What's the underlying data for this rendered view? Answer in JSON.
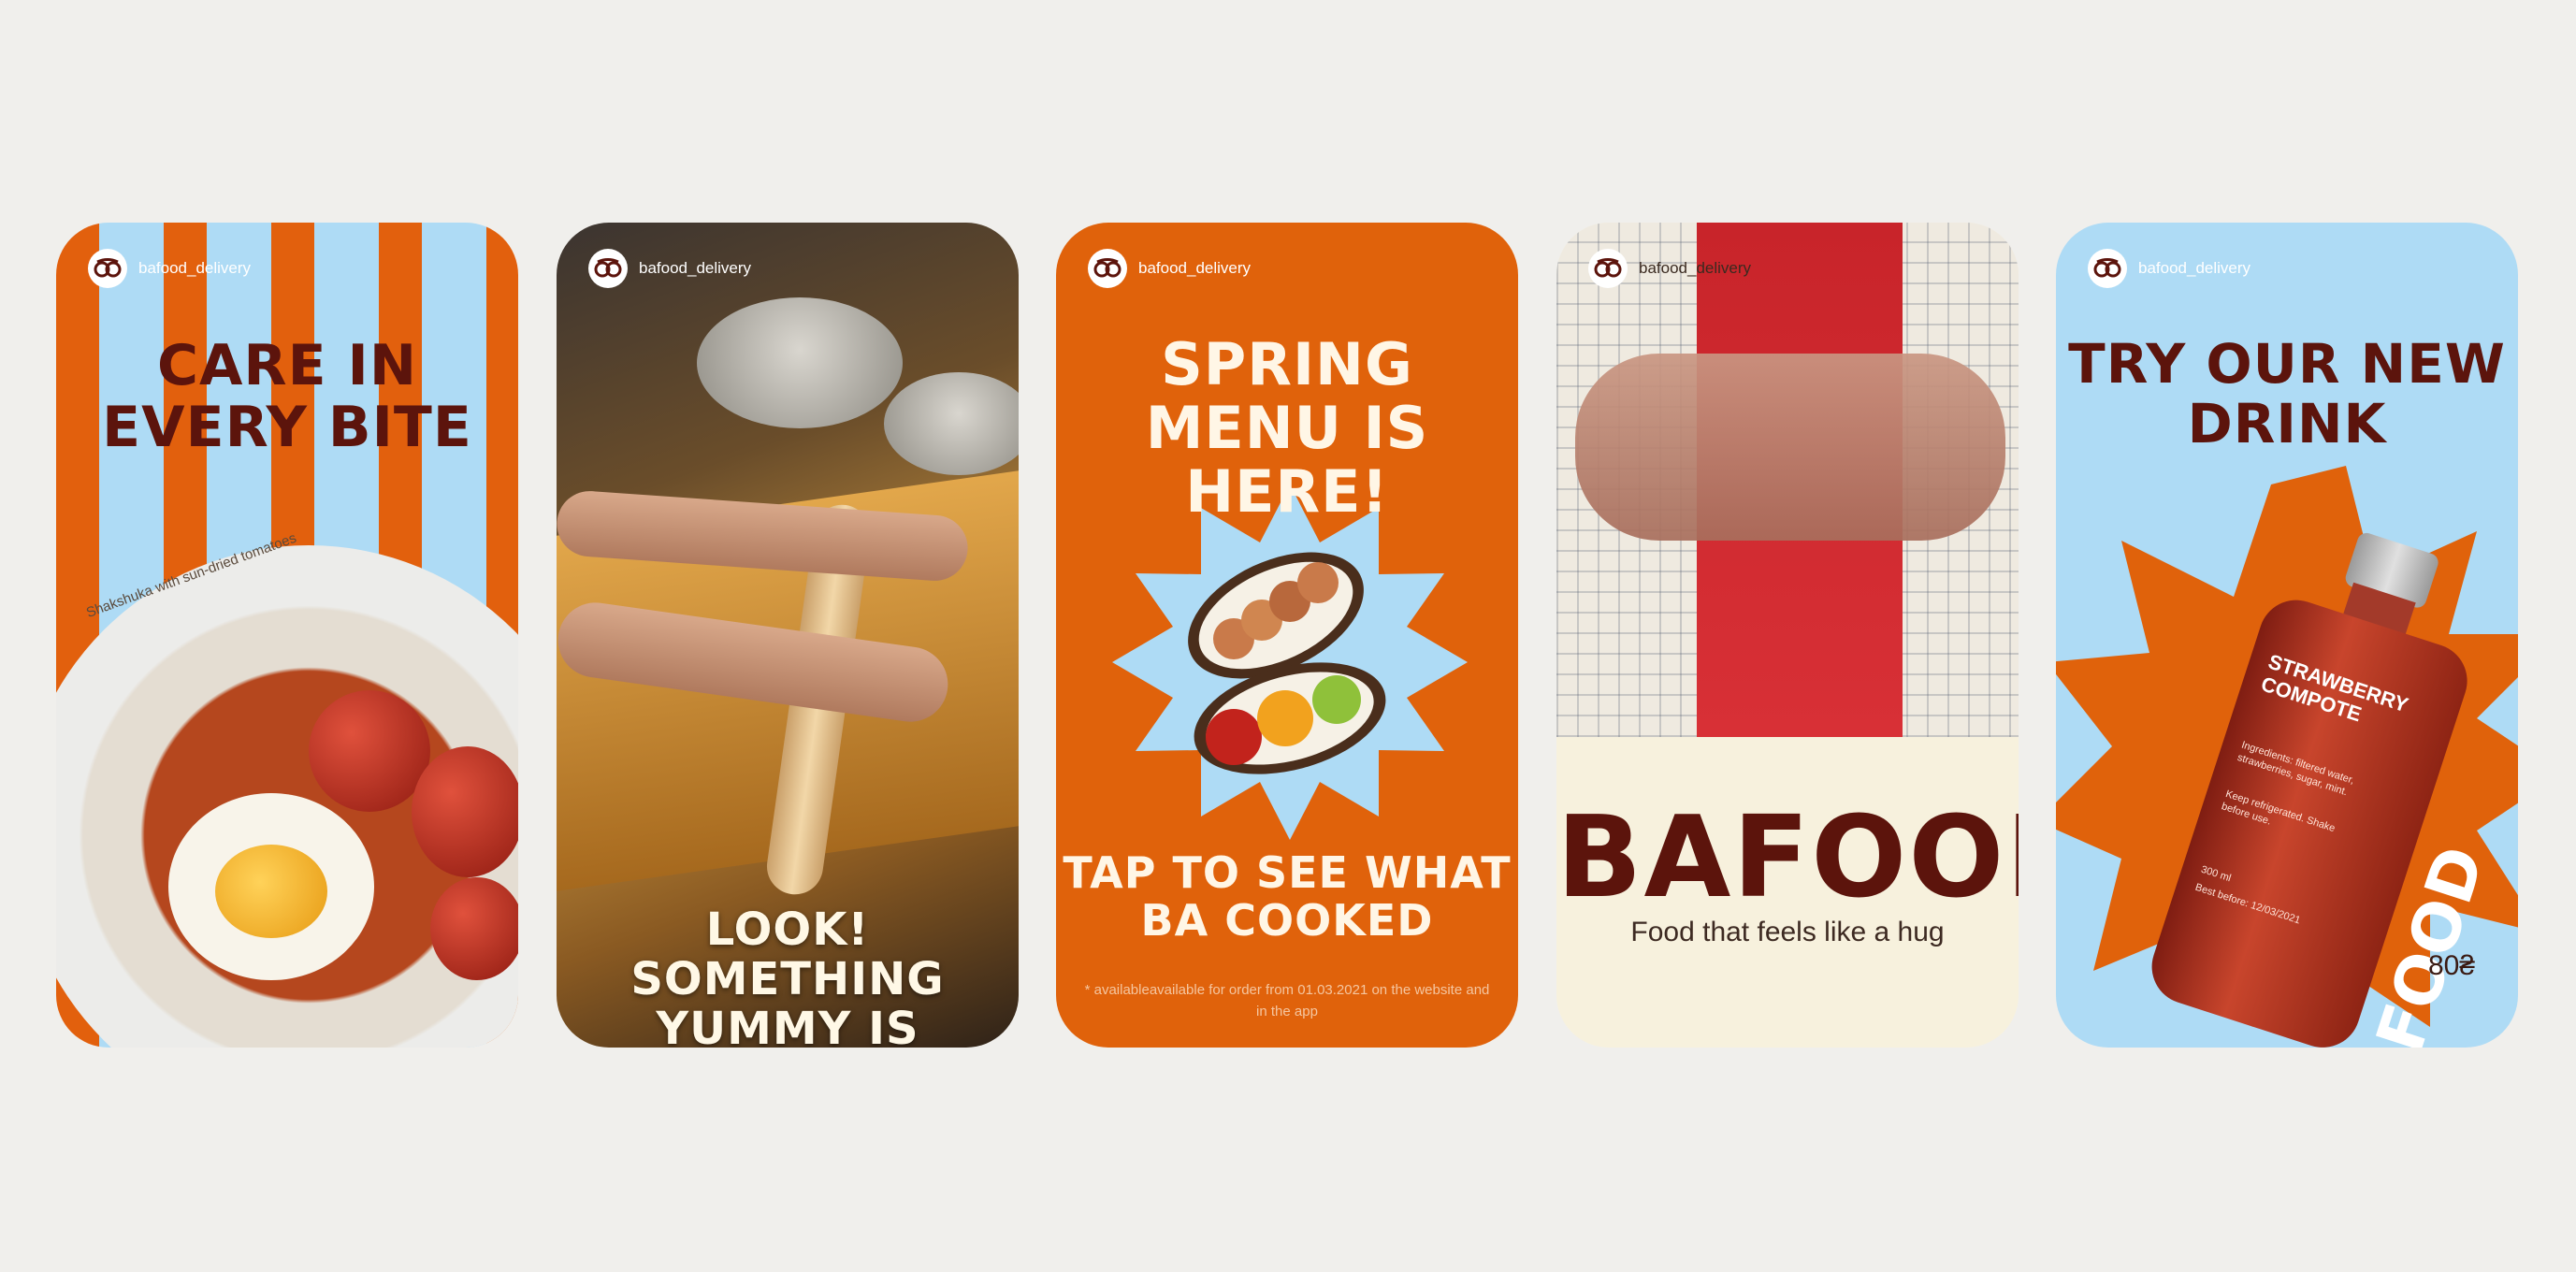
{
  "handle": "bafood_delivery",
  "cards": [
    {
      "headline": "CARE IN EVERY BITE",
      "caption": "Shakshuka with sun-dried tomatoes"
    },
    {
      "headline": "LOOK! SOMETHING YUMMY IS COOKING"
    },
    {
      "headline_top": "SPRING MENU IS HERE!",
      "headline_bottom": "TAP TO SEE WHAT BA COOKED",
      "footnote": "* availableavailable for order from 01.03.2021 on the website and in the app"
    },
    {
      "brand": "BAFOOD",
      "tagline": "Food that feels like a hug"
    },
    {
      "headline": "TRY OUR NEW DRINK",
      "bottle_name": "STRAWBERRY COMPOTE",
      "ingredients": "Ingredients: filtered water, strawberries, sugar, mint.",
      "storage": "Keep refrigerated. Shake before use.",
      "volume": "300 ml",
      "best_before": "Best before: 12/03/2021",
      "bottle_brand": "BAFOOD",
      "price": "80₴"
    }
  ],
  "colors": {
    "orange": "#e0620b",
    "sky": "#aedbf5",
    "maroon": "#5c140c",
    "cream": "#f7f1dd"
  }
}
